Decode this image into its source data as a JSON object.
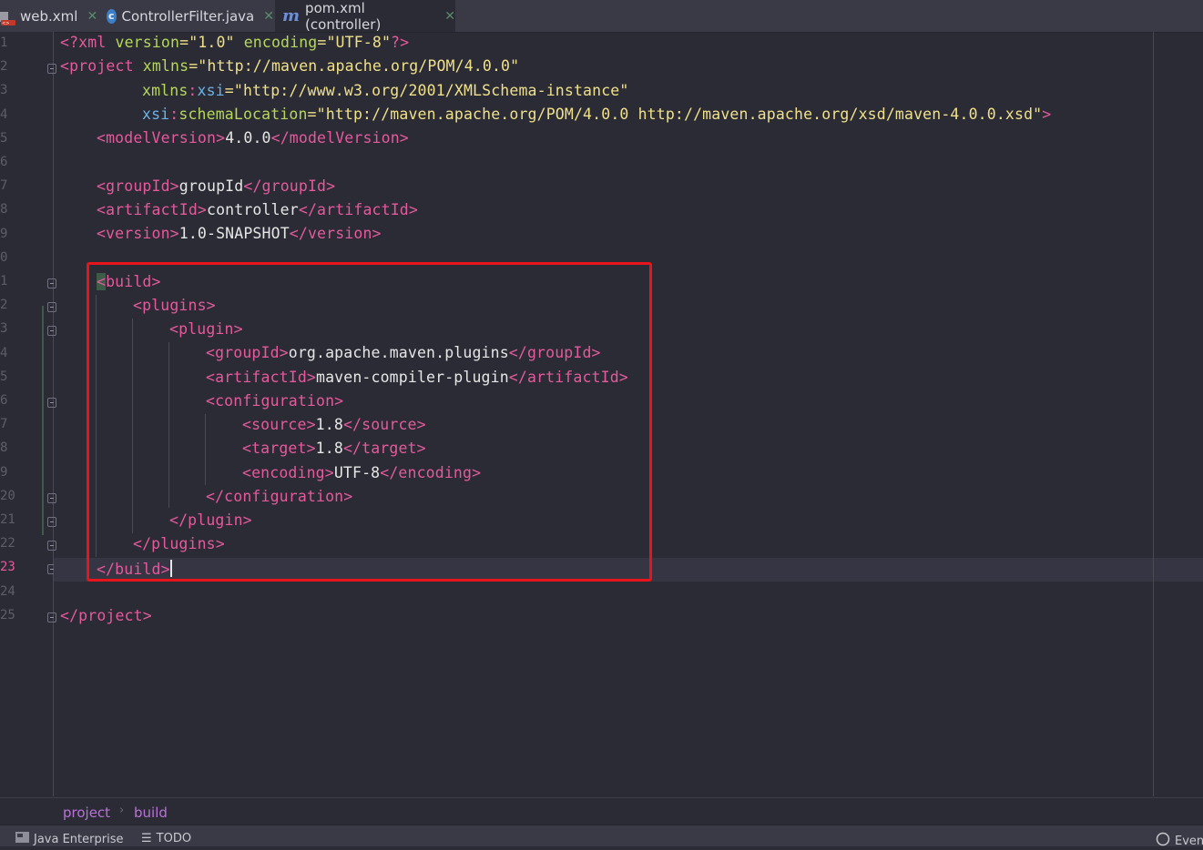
{
  "tabs": [
    {
      "label": "web.xml",
      "icon": "xml-file-icon"
    },
    {
      "label": "ControllerFilter.java",
      "icon": "java-class-icon"
    },
    {
      "label": "pom.xml (controller)",
      "icon": "maven-icon",
      "active": true
    }
  ],
  "gutter": {
    "line_numbers": [
      "1",
      "2",
      "3",
      "4",
      "5",
      "6",
      "7",
      "8",
      "9",
      "0",
      "1",
      "2",
      "3",
      "4",
      "5",
      "6",
      "7",
      "8",
      "9",
      "20",
      "21",
      "22",
      "23",
      "24",
      "25"
    ],
    "current_line": "23"
  },
  "code": {
    "l1": {
      "a": "<?xml ",
      "b": "version",
      "c": "=\"1.0\" ",
      "d": "encoding",
      "e": "=\"UTF-8\"",
      "f": "?>"
    },
    "l2": {
      "a": "<project ",
      "b": "xmlns",
      "c": "=\"http://maven.apache.org/POM/4.0.0\""
    },
    "l3": {
      "ns": "xmlns",
      "colon": ":",
      "b": "xsi",
      "c": "=\"http://www.w3.org/2001/XMLSchema-instance\""
    },
    "l4": {
      "ns": "xsi",
      "colon": ":",
      "b": "schemaLocation",
      "c": "=\"http://maven.apache.org/POM/4.0.0 http://maven.apache.org/xsd/maven-4.0.0.xsd\"",
      "d": ">"
    },
    "l5": {
      "open": "<modelVersion>",
      "text": "4.0.0",
      "close": "</modelVersion>"
    },
    "l7": {
      "open": "<groupId>",
      "text": "groupId",
      "close": "</groupId>"
    },
    "l8": {
      "open": "<artifactId>",
      "text": "controller",
      "close": "</artifactId>"
    },
    "l9": {
      "open": "<version>",
      "text": "1.0-SNAPSHOT",
      "close": "</version>"
    },
    "l11": {
      "lt": "<",
      "rest": "build>"
    },
    "l12": "<plugins>",
    "l13": "<plugin>",
    "l14": {
      "open": "<groupId>",
      "text": "org.apache.maven.plugins",
      "close": "</groupId>"
    },
    "l15": {
      "open": "<artifactId>",
      "text": "maven-compiler-plugin",
      "close": "</artifactId>"
    },
    "l16": "<configuration>",
    "l17": {
      "open": "<source>",
      "text": "1.8",
      "close": "</source>"
    },
    "l18": {
      "open": "<target>",
      "text": "1.8",
      "close": "</target>"
    },
    "l19": {
      "open": "<encoding>",
      "text": "UTF-8",
      "close": "</encoding>"
    },
    "l20": "</configuration>",
    "l21": "</plugin>",
    "l22": "</plugins>",
    "l23": "</build>",
    "l25": "</project>"
  },
  "breadcrumb": [
    "project",
    "build"
  ],
  "toolbar": {
    "java_enterprise": "Java Enterprise",
    "todo": "TODO",
    "event": "Event"
  },
  "colors": {
    "tag": "#e45a9c",
    "attribute": "#b6d75a",
    "value": "#f0e08a",
    "highlight_box": "#e8141c"
  }
}
